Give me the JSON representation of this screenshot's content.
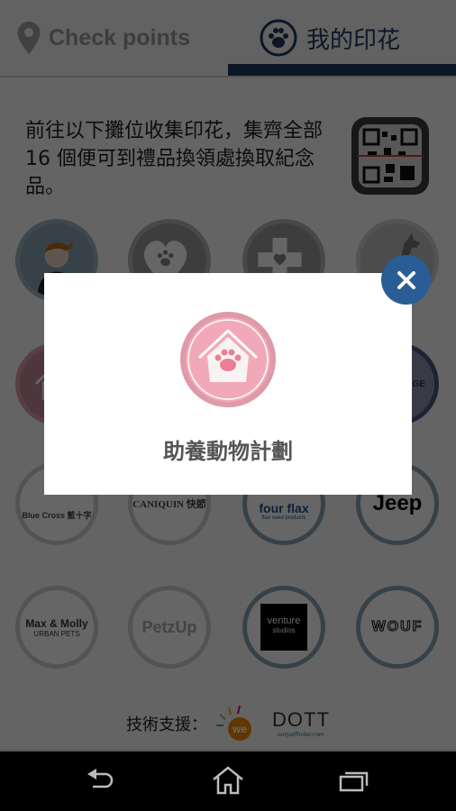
{
  "tabs": {
    "checkpoints": {
      "label": "Check points",
      "icon": "location-pin-icon"
    },
    "my_stamps": {
      "label": "我的印花",
      "icon": "paw-icon",
      "active": true
    }
  },
  "intro": {
    "text": "前往以下攤位收集印花，集齊全部 16 個便可到禮品換領處換取紀念品。"
  },
  "qr_button": {
    "icon": "qr-scan-icon"
  },
  "badges": [
    {
      "name": "staff-avatar",
      "label": ""
    },
    {
      "name": "heart-paw",
      "label": ""
    },
    {
      "name": "medical-cross-heart",
      "label": ""
    },
    {
      "name": "dog-silhouette",
      "label": ""
    },
    {
      "name": "adoption-house",
      "label": ""
    },
    {
      "name": "blank-2",
      "label": ""
    },
    {
      "name": "blank-3",
      "label": ""
    },
    {
      "name": "challenge-medal",
      "label": "CHALLENGE"
    },
    {
      "name": "blue-cross",
      "label": "Blue Cross 藍十字"
    },
    {
      "name": "caniquin",
      "label": "CANIQUIN 快節"
    },
    {
      "name": "fourflax",
      "label": "four flax",
      "sub": "flax seed products"
    },
    {
      "name": "jeep",
      "label": "Jeep"
    },
    {
      "name": "max-molly",
      "label": "Max & Molly",
      "sub": "URBAN PETS"
    },
    {
      "name": "petzup",
      "label": "PetzUp"
    },
    {
      "name": "venture-studios",
      "label": "venture",
      "sub": "studios"
    },
    {
      "name": "wouf",
      "label": "WOUF"
    }
  ],
  "footer": {
    "label": "技術支援：",
    "logos": [
      "we",
      "DOTT"
    ],
    "dott_sub": "ourpetfinder.com"
  },
  "modal": {
    "title": "助養動物計劃",
    "stamp_icon": "paw-house-icon",
    "close_icon": "close-icon"
  },
  "colors": {
    "accent": "#1c3a63",
    "close_button": "#2a5d95",
    "stamp_pink": "#f2a9b7"
  },
  "navbar": {
    "back": "back-icon",
    "home": "home-icon",
    "recents": "recents-icon"
  }
}
